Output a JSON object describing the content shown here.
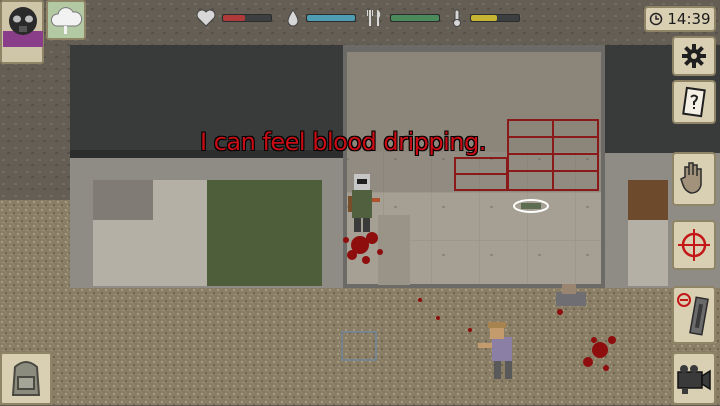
{
  "player": {
    "speech": "I can feel blood dripping."
  },
  "clock": {
    "time": "14:39",
    "icon": "clock-icon"
  },
  "status": {
    "health": {
      "icon": "heart-icon",
      "level": 0.45,
      "color": "#b03a3a"
    },
    "thirst": {
      "icon": "water-drop-icon",
      "level": 1.0,
      "color": "#4f9db2"
    },
    "hunger": {
      "icon": "fork-knife-icon",
      "level": 1.0,
      "color": "#4b8a5a"
    },
    "temperature": {
      "icon": "thermometer-icon",
      "level": 0.55,
      "color": "#c7b433"
    }
  },
  "left_panel": {
    "avatar_icon": "gasmask-portrait-icon",
    "weather_icon": "cloud-icon",
    "backpack_icon": "backpack-icon"
  },
  "right_panel": {
    "settings_icon": "gear-icon",
    "journal_icon": "journal-icon",
    "crafting_icon": "hand-icon",
    "aim_icon": "crosshair-icon",
    "weapon_icon": "weapon-icon",
    "camera_icon": "camcorder-icon"
  },
  "colors": {
    "blood": "#8e0d0d",
    "speech": "#c90d14"
  }
}
